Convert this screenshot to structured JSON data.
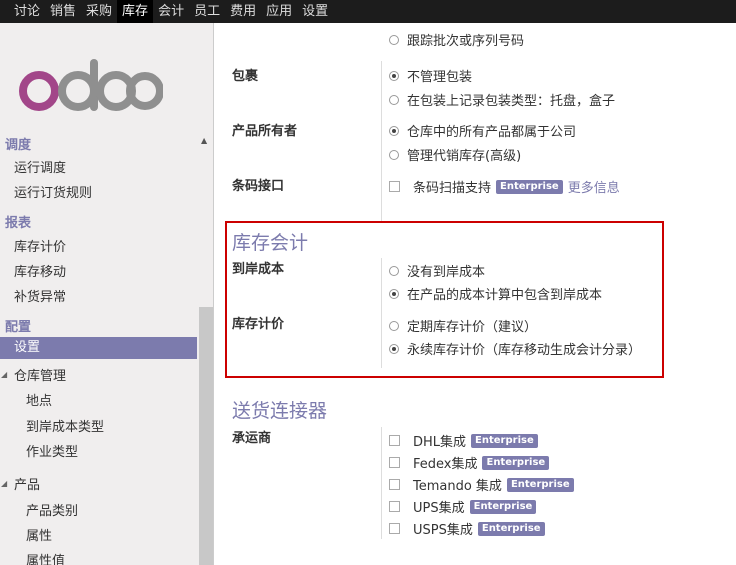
{
  "topnav": {
    "items": [
      "讨论",
      "销售",
      "采购",
      "库存",
      "会计",
      "员工",
      "费用",
      "应用",
      "设置"
    ],
    "active_index": 3
  },
  "brand": {
    "logo_text": "odoo"
  },
  "sidebar": {
    "sections": [
      {
        "title": "调度",
        "items": [
          "运行调度",
          "运行订货规则"
        ]
      },
      {
        "title": "报表",
        "items": [
          "库存计价",
          "库存移动",
          "补货异常"
        ]
      },
      {
        "title": "配置",
        "items": [
          "设置"
        ]
      }
    ],
    "warehouse_group": {
      "label": "仓库管理",
      "items": [
        "地点",
        "到岸成本类型",
        "作业类型"
      ]
    },
    "product_group": {
      "label": "产品",
      "items": [
        "产品类别",
        "属性",
        "属性值"
      ]
    }
  },
  "settings": {
    "lot_option": "跟踪批次或序列号码",
    "packaging": {
      "label": "包裹",
      "options": [
        "不管理包装",
        "在包装上记录包装类型：托盘，盒子"
      ],
      "selected": 0
    },
    "product_owner": {
      "label": "产品所有者",
      "options": [
        "仓库中的所有产品都属于公司",
        "管理代销库存(高级)"
      ],
      "selected": 0
    },
    "barcode": {
      "label": "条码接口",
      "option": "条码扫描支持",
      "badge": "Enterprise",
      "link": "更多信息"
    },
    "accounting_section": {
      "title": "库存会计",
      "landed_cost": {
        "label": "到岸成本",
        "options": [
          "没有到岸成本",
          "在产品的成本计算中包含到岸成本"
        ],
        "selected": 1
      },
      "valuation": {
        "label": "库存计价",
        "options": [
          "定期库存计价（建议）",
          "永续库存计价（库存移动生成会计分录）"
        ],
        "selected": 1
      }
    },
    "shipping_section": {
      "title": "送货连接器",
      "carrier_label": "承运商",
      "carriers": [
        "DHL集成",
        "Fedex集成",
        "Temando 集成",
        "UPS集成",
        "USPS集成"
      ],
      "badge": "Enterprise"
    }
  }
}
